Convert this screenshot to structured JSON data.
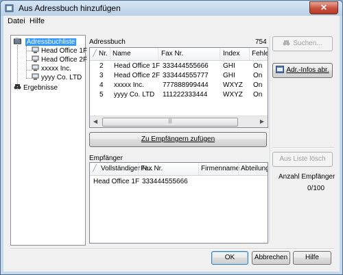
{
  "window": {
    "title": "Aus Adressbuch hinzufügen",
    "close_glyph": "✕"
  },
  "menu": {
    "datei": "Datei",
    "hilfe": "Hilfe"
  },
  "tree": {
    "root": "Adressbuchliste",
    "children": [
      "Head Office 1F",
      "Head Office 2F",
      "xxxxx Inc.",
      "yyyy Co. LTD"
    ],
    "results": "Ergebnisse"
  },
  "addressbook": {
    "label": "Adressbuch",
    "count": "754",
    "columns": [
      "Nr.",
      "Name",
      "Fax Nr.",
      "Index",
      "Fehle..."
    ],
    "rows": [
      {
        "nr": "2",
        "name": "Head Office 1F",
        "fax": "333444555666",
        "index": "GHI",
        "status": "On"
      },
      {
        "nr": "3",
        "name": "Head Office 2F",
        "fax": "333444555777",
        "index": "GHI",
        "status": "On"
      },
      {
        "nr": "4",
        "name": "xxxxx Inc.",
        "fax": "777888999444",
        "index": "WXYZ",
        "status": "On"
      },
      {
        "nr": "5",
        "name": "yyyy Co. LTD",
        "fax": "111222333444",
        "index": "WXYZ",
        "status": "On"
      }
    ]
  },
  "add_button": "Zu Empfängern zufügen",
  "recipients": {
    "label": "Empfänger",
    "columns": [
      "Vollständiger N...",
      "Fax Nr.",
      "Firmenname",
      "Abteilung"
    ],
    "rows": [
      {
        "name": "Head Office 1F",
        "fax": "333444555666"
      }
    ]
  },
  "side": {
    "search": "Suchen...",
    "addr_info": "Adr.-Infos abr.",
    "delete_list": "Aus Liste lösch",
    "count_label": "Anzahl Empfänger",
    "count_value": "0/100"
  },
  "footer": {
    "ok": "OK",
    "cancel": "Abbrechen",
    "help": "Hilfe"
  },
  "scroll_arrows": {
    "left": "◀",
    "right": "▶"
  },
  "scroll_grip": "|||"
}
